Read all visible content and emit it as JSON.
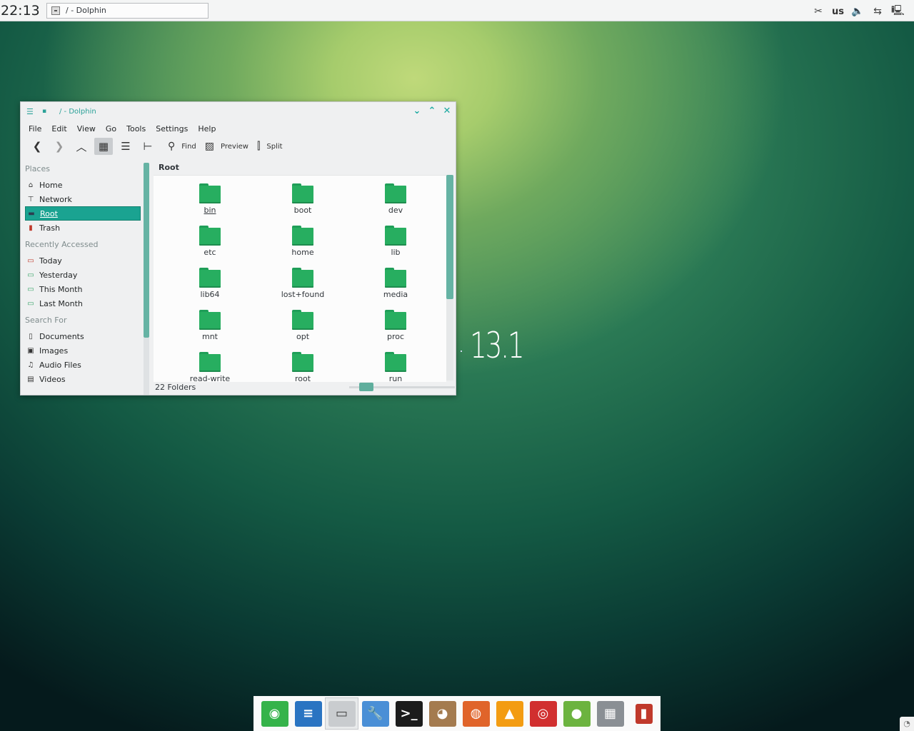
{
  "panel": {
    "clock": "22:13",
    "task_title": "/ - Dolphin",
    "keyboard_layout": "us"
  },
  "window": {
    "title": "/ - Dolphin",
    "menu": [
      "File",
      "Edit",
      "View",
      "Go",
      "Tools",
      "Settings",
      "Help"
    ],
    "toolbar": {
      "find": "Find",
      "preview": "Preview",
      "split": "Split",
      "active_view": "icons"
    },
    "places": {
      "sections": {
        "places": "Places",
        "recent": "Recently Accessed",
        "search": "Search For"
      },
      "places_items": [
        "Home",
        "Network",
        "Root",
        "Trash"
      ],
      "recent_items": [
        "Today",
        "Yesterday",
        "This Month",
        "Last Month"
      ],
      "search_items": [
        "Documents",
        "Images",
        "Audio Files",
        "Videos"
      ],
      "selected": "Root"
    },
    "breadcrumb": "Root",
    "folders": [
      "bin",
      "boot",
      "dev",
      "etc",
      "home",
      "lib",
      "lib64",
      "lost+found",
      "media",
      "mnt",
      "opt",
      "proc",
      "read-write",
      "root",
      "run"
    ],
    "status": "22 Folders",
    "accent": "#1aa391",
    "folder_color": "#27ae60"
  },
  "desktop": {
    "version": "13.1"
  },
  "dock": {
    "apps": [
      "opensuse-icon",
      "writer-icon",
      "file-manager-icon",
      "settings-wrench-icon",
      "terminal-icon",
      "gimp-icon",
      "firefox-icon",
      "vlc-icon",
      "disc-burner-icon",
      "pidgin-icon",
      "calculator-icon",
      "trash-icon"
    ],
    "current": "file-manager-icon"
  }
}
